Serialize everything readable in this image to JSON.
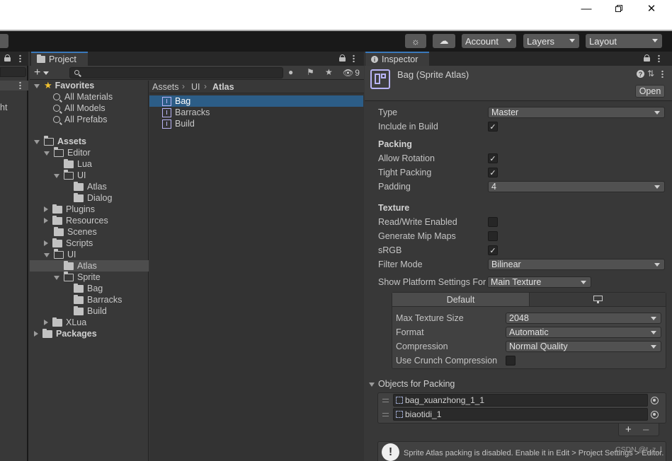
{
  "toolbar": {
    "account_label": "Account",
    "layers_label": "Layers",
    "layout_label": "Layout"
  },
  "left_edge": {
    "clipped_text": "ht"
  },
  "project": {
    "tab_label": "Project",
    "hidden_count": "9",
    "favorites": {
      "label": "Favorites",
      "items": [
        "All Materials",
        "All Models",
        "All Prefabs"
      ]
    },
    "tree": {
      "assets": "Assets",
      "editor": "Editor",
      "lua": "Lua",
      "ui_editor": "UI",
      "atlas_editor": "Atlas",
      "dialog": "Dialog",
      "plugins": "Plugins",
      "resources": "Resources",
      "scenes": "Scenes",
      "scripts": "Scripts",
      "ui": "UI",
      "atlas": "Atlas",
      "sprite": "Sprite",
      "bag": "Bag",
      "barracks": "Barracks",
      "build": "Build",
      "xlua": "XLua",
      "packages": "Packages"
    },
    "breadcrumb": [
      "Assets",
      "UI",
      "Atlas"
    ],
    "files": [
      "Bag",
      "Barracks",
      "Build"
    ]
  },
  "inspector": {
    "tab_label": "Inspector",
    "asset_title": "Bag (Sprite Atlas)",
    "open_label": "Open",
    "type_label": "Type",
    "type_value": "Master",
    "include_build_label": "Include in Build",
    "packing_header": "Packing",
    "allow_rotation_label": "Allow Rotation",
    "tight_packing_label": "Tight Packing",
    "padding_label": "Padding",
    "padding_value": "4",
    "texture_header": "Texture",
    "read_write_label": "Read/Write Enabled",
    "mipmaps_label": "Generate Mip Maps",
    "srgb_label": "sRGB",
    "filter_mode_label": "Filter Mode",
    "filter_mode_value": "Bilinear",
    "platform_settings_label": "Show Platform Settings For",
    "platform_settings_value": "Main Texture",
    "default_tab": "Default",
    "max_texture_label": "Max Texture Size",
    "max_texture_value": "2048",
    "format_label": "Format",
    "format_value": "Automatic",
    "compression_label": "Compression",
    "compression_value": "Normal Quality",
    "crunch_label": "Use Crunch Compression",
    "objects_header": "Objects for Packing",
    "objects": [
      "bag_xuanzhong_1_1",
      "biaotidi_1"
    ],
    "help_text": "Sprite Atlas packing is disabled. Enable it in Edit > Project Settings > Editor.",
    "watermark": "CSDN @t_z_l"
  },
  "colors": {
    "accent": "#3a79bb",
    "selection": "#2c5d87",
    "atlas_icon": "#b9b4f5"
  }
}
